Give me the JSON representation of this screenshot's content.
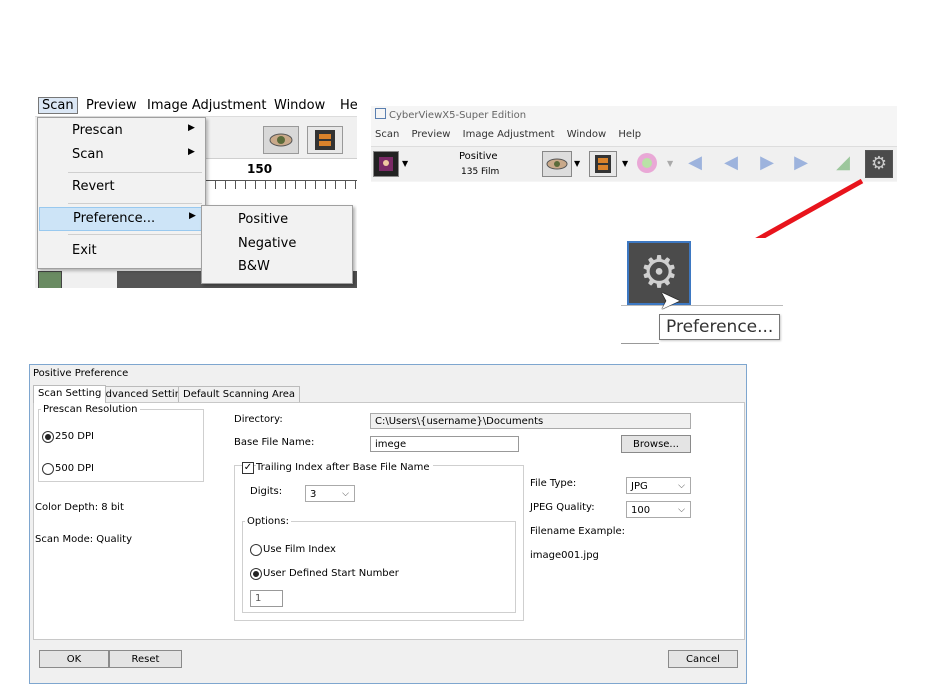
{
  "menu_screenshot": {
    "menubar": [
      "Scan",
      "Preview",
      "Image Adjustment",
      "Window",
      "He"
    ],
    "scan_menu": [
      "Prescan",
      "Scan",
      "Revert",
      "Preference...",
      "Exit"
    ],
    "preference_submenu": [
      "Positive",
      "Negative",
      "B&W"
    ],
    "ruler_label": "150"
  },
  "toolbar_screenshot": {
    "window_title": "CyberViewX5-Super Edition",
    "menus": [
      "Scan",
      "Preview",
      "Image Adjustment",
      "Window",
      "Help"
    ],
    "mode_label": "Positive",
    "film_label": "135 Film",
    "accent_color": "#e8141c",
    "icons": [
      "scan-thumbnail-icon",
      "eye-preview-icon",
      "film-strip-icon",
      "color-wheel-icon",
      "first-frame-icon",
      "prev-frame-icon",
      "next-frame-icon",
      "last-frame-icon",
      "scanner-icon",
      "gear-icon"
    ]
  },
  "zoom_callout": {
    "tooltip": "Preference..."
  },
  "dialog": {
    "title": "Positive Preference",
    "tabs": [
      "Scan Setting",
      "Advanced Setting",
      "Default Scanning Area"
    ],
    "prescan_group": "Prescan Resolution",
    "dpi_250": "250 DPI",
    "dpi_500": "500 DPI",
    "color_depth": "Color Depth: 8 bit",
    "scan_mode": "Scan Mode: Quality",
    "directory_label": "Directory:",
    "directory_value": "C:\\Users\\{username}\\Documents",
    "base_name_label": "Base File Name:",
    "base_name_value": "imege",
    "browse": "Browse...",
    "trailing_label": "Trailing Index after Base File Name",
    "digits_label": "Digits:",
    "digits_value": "3",
    "options_label": "Options:",
    "use_film_index": "Use Film Index",
    "user_defined": "User Defined Start Number",
    "start_number": "1",
    "file_type_label": "File Type:",
    "file_type_value": "JPG",
    "jpeg_quality_label": "JPEG Quality:",
    "jpeg_quality_value": "100",
    "filename_example_label": "Filename Example:",
    "filename_example_value": "image001.jpg",
    "ok": "OK",
    "reset": "Reset",
    "cancel": "Cancel"
  }
}
